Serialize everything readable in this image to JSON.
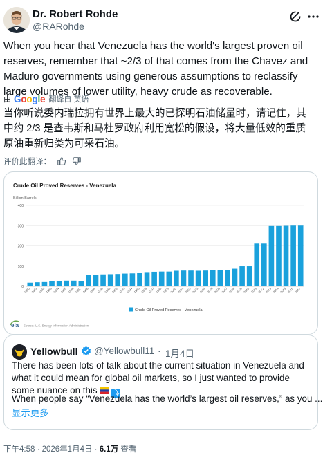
{
  "author": {
    "name": "Dr. Robert Rohde",
    "handle": "@RARohde"
  },
  "tweet": {
    "text_en": "When you hear that Venezuela has the world's largest proven oil reserves, remember that ~2/3 of that comes from the Chavez and Maduro governments using generous assumptions to reclassify large volumes of lower utility, heavy crude as recoverable.",
    "translate_by": "由",
    "translate_brand": "Google",
    "translate_label": "翻译自 英语",
    "text_zh": "当你听说委内瑞拉拥有世界上最大的已探明石油储量时，请记住，其中约 2/3 是查韦斯和马杜罗政府利用宽松的假设，将大量低效的重质原油重新归类为可采石油。",
    "rate_label": "评价此翻译：",
    "icons": [
      "thumbs-up-icon",
      "thumbs-down-icon",
      "grok-icon",
      "more-icon"
    ]
  },
  "chart_data": {
    "type": "bar",
    "title": "Crude Oil Proved Reserves - Venezuela",
    "ylabel": "Billion Barrels",
    "ylim": [
      0,
      400
    ],
    "yticks": [
      "0",
      "100",
      "200",
      "300",
      "400"
    ],
    "legend": "Crude Oil Proved Reserves - Venezuela",
    "legend_position": "bottom",
    "source": "Source: U.S. Energy Information Administration",
    "source_logo": "eia",
    "bar_color": "#1aa1dc",
    "categories": [
      "1980",
      "1981",
      "1982",
      "1983",
      "1984",
      "1985",
      "1986",
      "1987",
      "1988",
      "1989",
      "1990",
      "1991",
      "1992",
      "1993",
      "1994",
      "1995",
      "1996",
      "1997",
      "1998",
      "1999",
      "2000",
      "2001",
      "2002",
      "2003",
      "2004",
      "2005",
      "2006",
      "2007",
      "2008",
      "2009",
      "2010",
      "2011",
      "2012",
      "2013",
      "2014",
      "2015",
      "2016",
      "2017"
    ],
    "values": [
      18,
      20,
      21,
      25,
      26,
      28,
      28,
      25,
      56,
      58,
      59,
      60,
      61,
      63,
      64,
      65,
      67,
      72,
      73,
      73,
      77,
      78,
      78,
      77,
      78,
      80,
      80,
      80,
      87,
      99,
      99,
      211,
      211,
      298,
      298,
      299,
      300,
      300
    ]
  },
  "quote": {
    "name": "Yellowbull",
    "handle": "@Yellowbull11",
    "dot": "·",
    "date": "1月4日",
    "text1": "There has been lots of talk about the current situation in Venezuela and what it could mean for global oil markets, so I just wanted to provide some nuance on this",
    "text2": "When people say “Venezuela has the world’s largest oil reserves,” as you ...",
    "show_more": "显示更多"
  },
  "meta": {
    "time": "下午4:58 · 2026年1月4日 · ",
    "views": "6.1万",
    "views_label": " 查看"
  },
  "colors": {
    "link": "#1d9bf0",
    "secondary": "#536471",
    "border": "#cfd9de"
  }
}
